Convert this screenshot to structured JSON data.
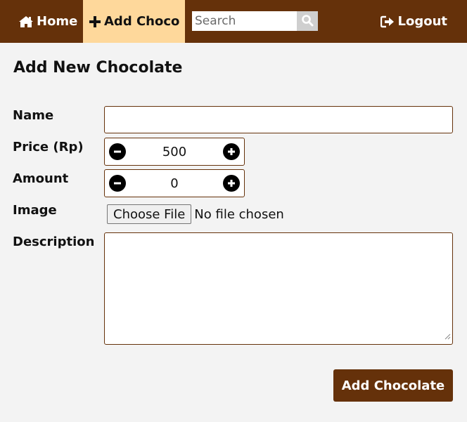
{
  "nav": {
    "home_label": "Home",
    "home_icon": "home-icon",
    "add_choco_label": "Add Choco",
    "add_choco_icon": "plus-icon",
    "search_placeholder": "Search",
    "search_icon": "search-icon",
    "logout_label": "Logout",
    "logout_icon": "logout-icon"
  },
  "page": {
    "title": "Add New Chocolate"
  },
  "form": {
    "name_label": "Name",
    "name_value": "",
    "price_label": "Price (Rp)",
    "price_value": "500",
    "amount_label": "Amount",
    "amount_value": "0",
    "image_label": "Image",
    "choose_file_label": "Choose File",
    "file_status": "No file chosen",
    "description_label": "Description",
    "description_value": "",
    "submit_label": "Add Chocolate"
  },
  "colors": {
    "navbar": "#65310a",
    "active_tab": "#fed89b",
    "background": "#f3f3f3",
    "button": "#65310a"
  }
}
